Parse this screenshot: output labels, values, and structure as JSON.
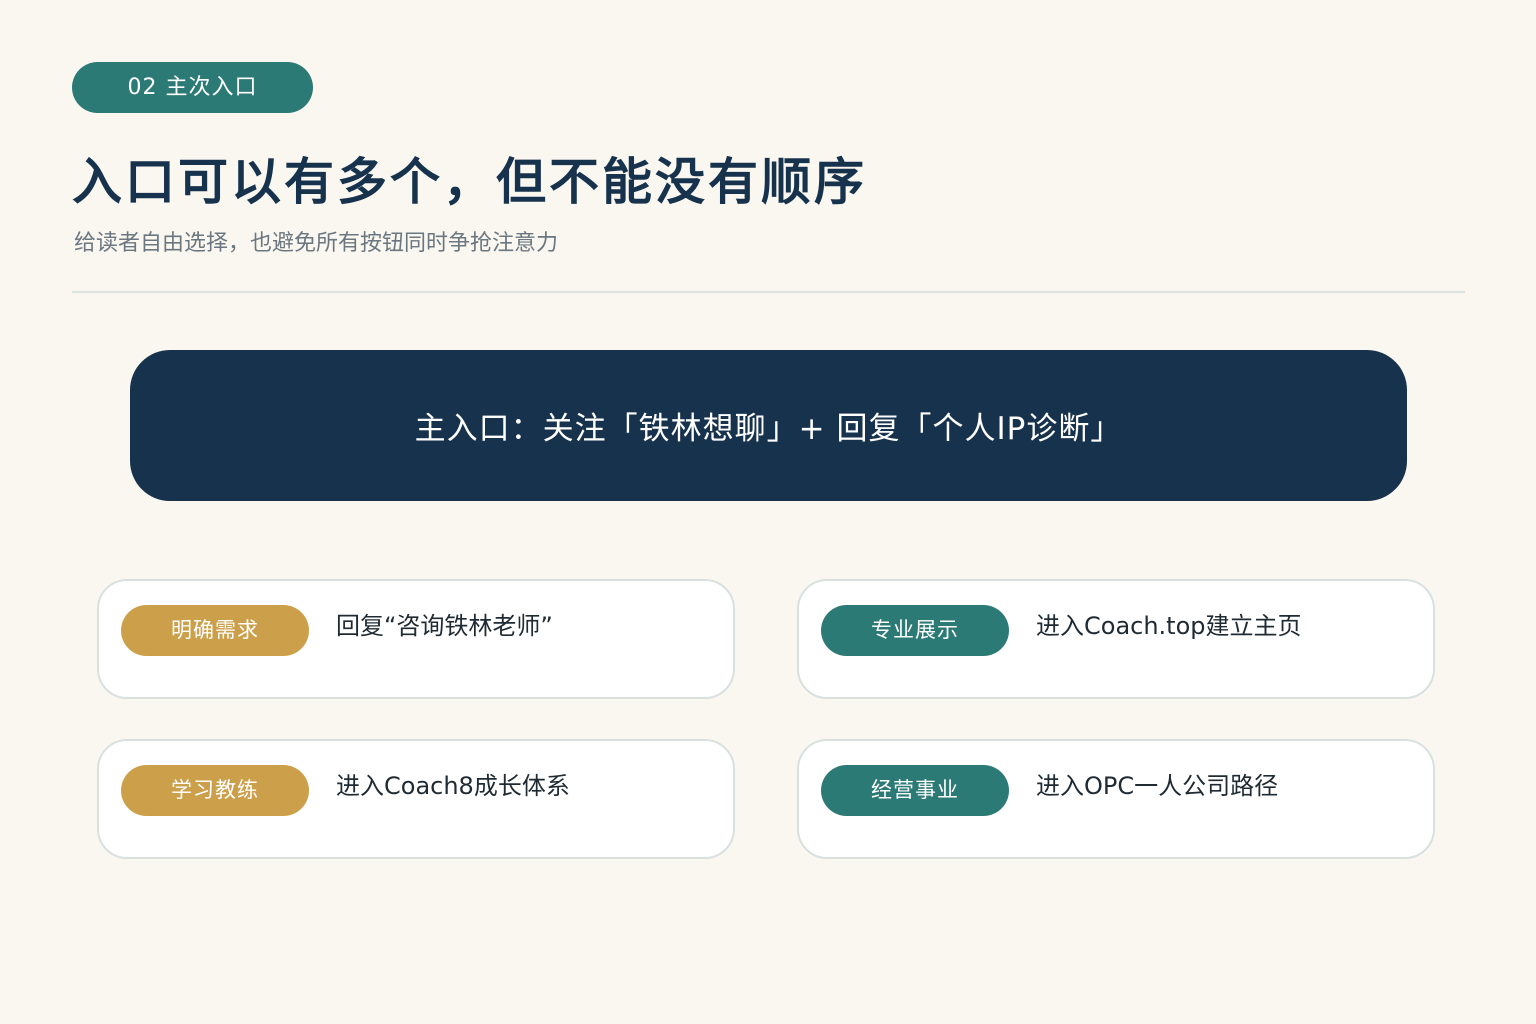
{
  "section_tag": "02  主次入口",
  "title": "入口可以有多个，但不能没有顺序",
  "subtitle": "给读者自由选择，也避免所有按钮同时争抢注意力",
  "primary_entry": "主入口：关注「铁林想聊」+ 回复「个人IP诊断」",
  "cards": [
    {
      "tag": "明确需求",
      "text": "回复“咨询铁林老师”",
      "tag_color": "#cc9f4a"
    },
    {
      "tag": "专业展示",
      "text": "进入Coach.top建立主页",
      "tag_color": "#2c7a76"
    },
    {
      "tag": "学习教练",
      "text": "进入Coach8成长体系",
      "tag_color": "#cc9f4a"
    },
    {
      "tag": "经营事业",
      "text": "进入OPC一人公司路径",
      "tag_color": "#2c7a76"
    }
  ],
  "colors": {
    "background": "#faf7f1",
    "navy": "#17324d",
    "teal": "#2c7a76",
    "gold": "#cc9f4a"
  }
}
